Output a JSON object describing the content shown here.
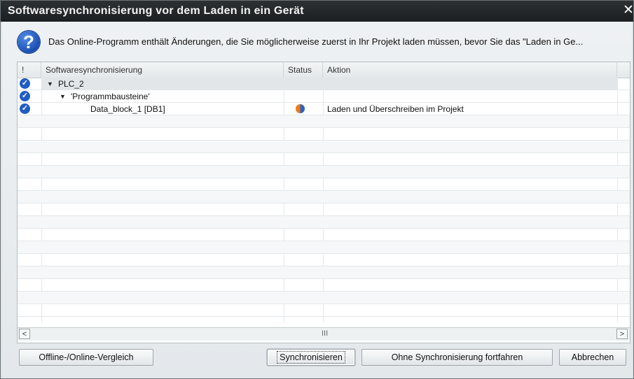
{
  "dialog": {
    "title": "Softwaresynchronisierung vor dem Laden in ein Gerät",
    "close_glyph": "✕",
    "message": "Das Online-Programm enthält Änderungen, die Sie möglicherweise zuerst in Ihr Projekt laden müssen, bevor Sie das \"Laden in Ge...",
    "question_icon": "?"
  },
  "table": {
    "columns": {
      "flag": "!",
      "name": "Softwaresynchronisierung",
      "status": "Status",
      "action": "Aktion"
    },
    "rows": [
      {
        "check": "✓",
        "expand": "▼",
        "name": "PLC_2",
        "action": ""
      },
      {
        "check": "✓",
        "expand": "▼",
        "name": "'Programmbausteine'",
        "action": ""
      },
      {
        "check": "✓",
        "expand": "",
        "name": "Data_block_1 [DB1]",
        "action": "Laden und Überschreiben im Projekt",
        "status_icon": "half-orange-half-blue-status-icon"
      }
    ],
    "scroll": {
      "left": "<",
      "right": ">",
      "grip": "III"
    }
  },
  "buttons": {
    "compare": "Offline-/Online-Vergleich",
    "synchronize": "Synchronisieren",
    "continue_without": "Ohne Synchronisierung fortfahren",
    "cancel": "Abbrechen"
  },
  "colors": {
    "titlebar": "#1c1f21",
    "accent_blue": "#1f5cc4",
    "status_orange": "#f07b14"
  }
}
